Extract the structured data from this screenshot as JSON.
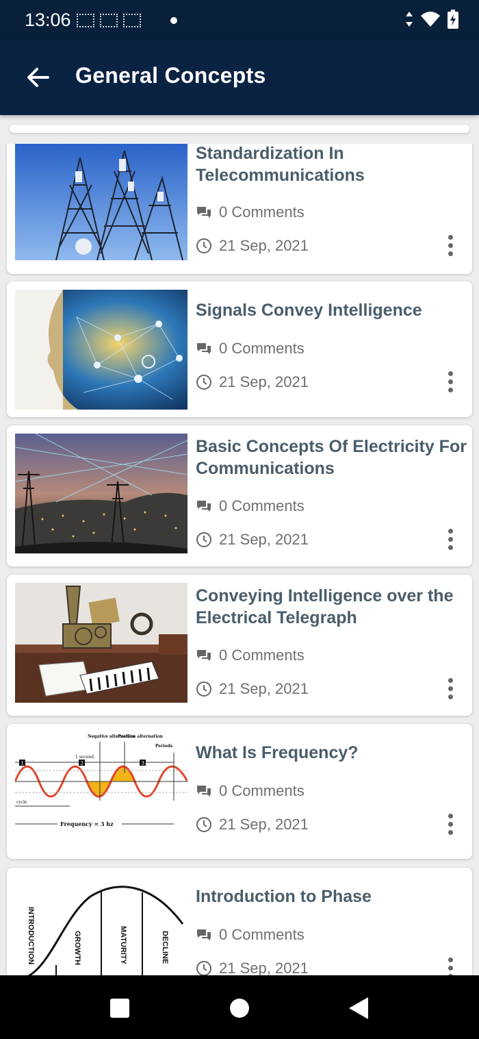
{
  "status_bar": {
    "time": "13:06"
  },
  "app_bar": {
    "title": "General Concepts"
  },
  "articles": [
    {
      "title": "Standardization In Telecommunications",
      "comments": "0 Comments",
      "date": "21 Sep, 2021",
      "thumbnail": "telecom-towers"
    },
    {
      "title": "Signals Convey Intelligence",
      "comments": "0 Comments",
      "date": "21 Sep, 2021",
      "thumbnail": "network-head"
    },
    {
      "title": "Basic Concepts Of Electricity For Communications",
      "comments": "0 Comments",
      "date": "21 Sep, 2021",
      "thumbnail": "power-lines-city"
    },
    {
      "title": "Conveying Intelligence over the Electrical Telegraph",
      "comments": "0 Comments",
      "date": "21 Sep, 2021",
      "thumbnail": "telegraph-machine"
    },
    {
      "title": "What Is Frequency?",
      "comments": "0 Comments",
      "date": "21 Sep, 2021",
      "thumbnail": "sine-wave-diagram"
    },
    {
      "title": "Introduction to Phase",
      "comments": "0 Comments",
      "date": "21 Sep, 2021",
      "thumbnail": "lifecycle-curve"
    }
  ],
  "diagrams": {
    "frequency": {
      "label_negative": "Negative alternation",
      "label_positive": "Positive alternation",
      "label_periods": "Periods",
      "label_second": "1 second",
      "label_cycle": "cycle",
      "label_frequency": "Frequency = 3 hz",
      "markers": [
        "1",
        "2",
        "3"
      ]
    },
    "phase": {
      "stages": [
        "INTRODUCTION",
        "GROWTH",
        "MATURITY",
        "DECLINE"
      ]
    }
  },
  "colors": {
    "app_bar": "#0b2343",
    "status_bar": "#08203a",
    "title_text": "#4a5d6a",
    "meta_text": "#6f6f6f",
    "wave": "#e0452a",
    "wave_fill": "#f2b417"
  }
}
